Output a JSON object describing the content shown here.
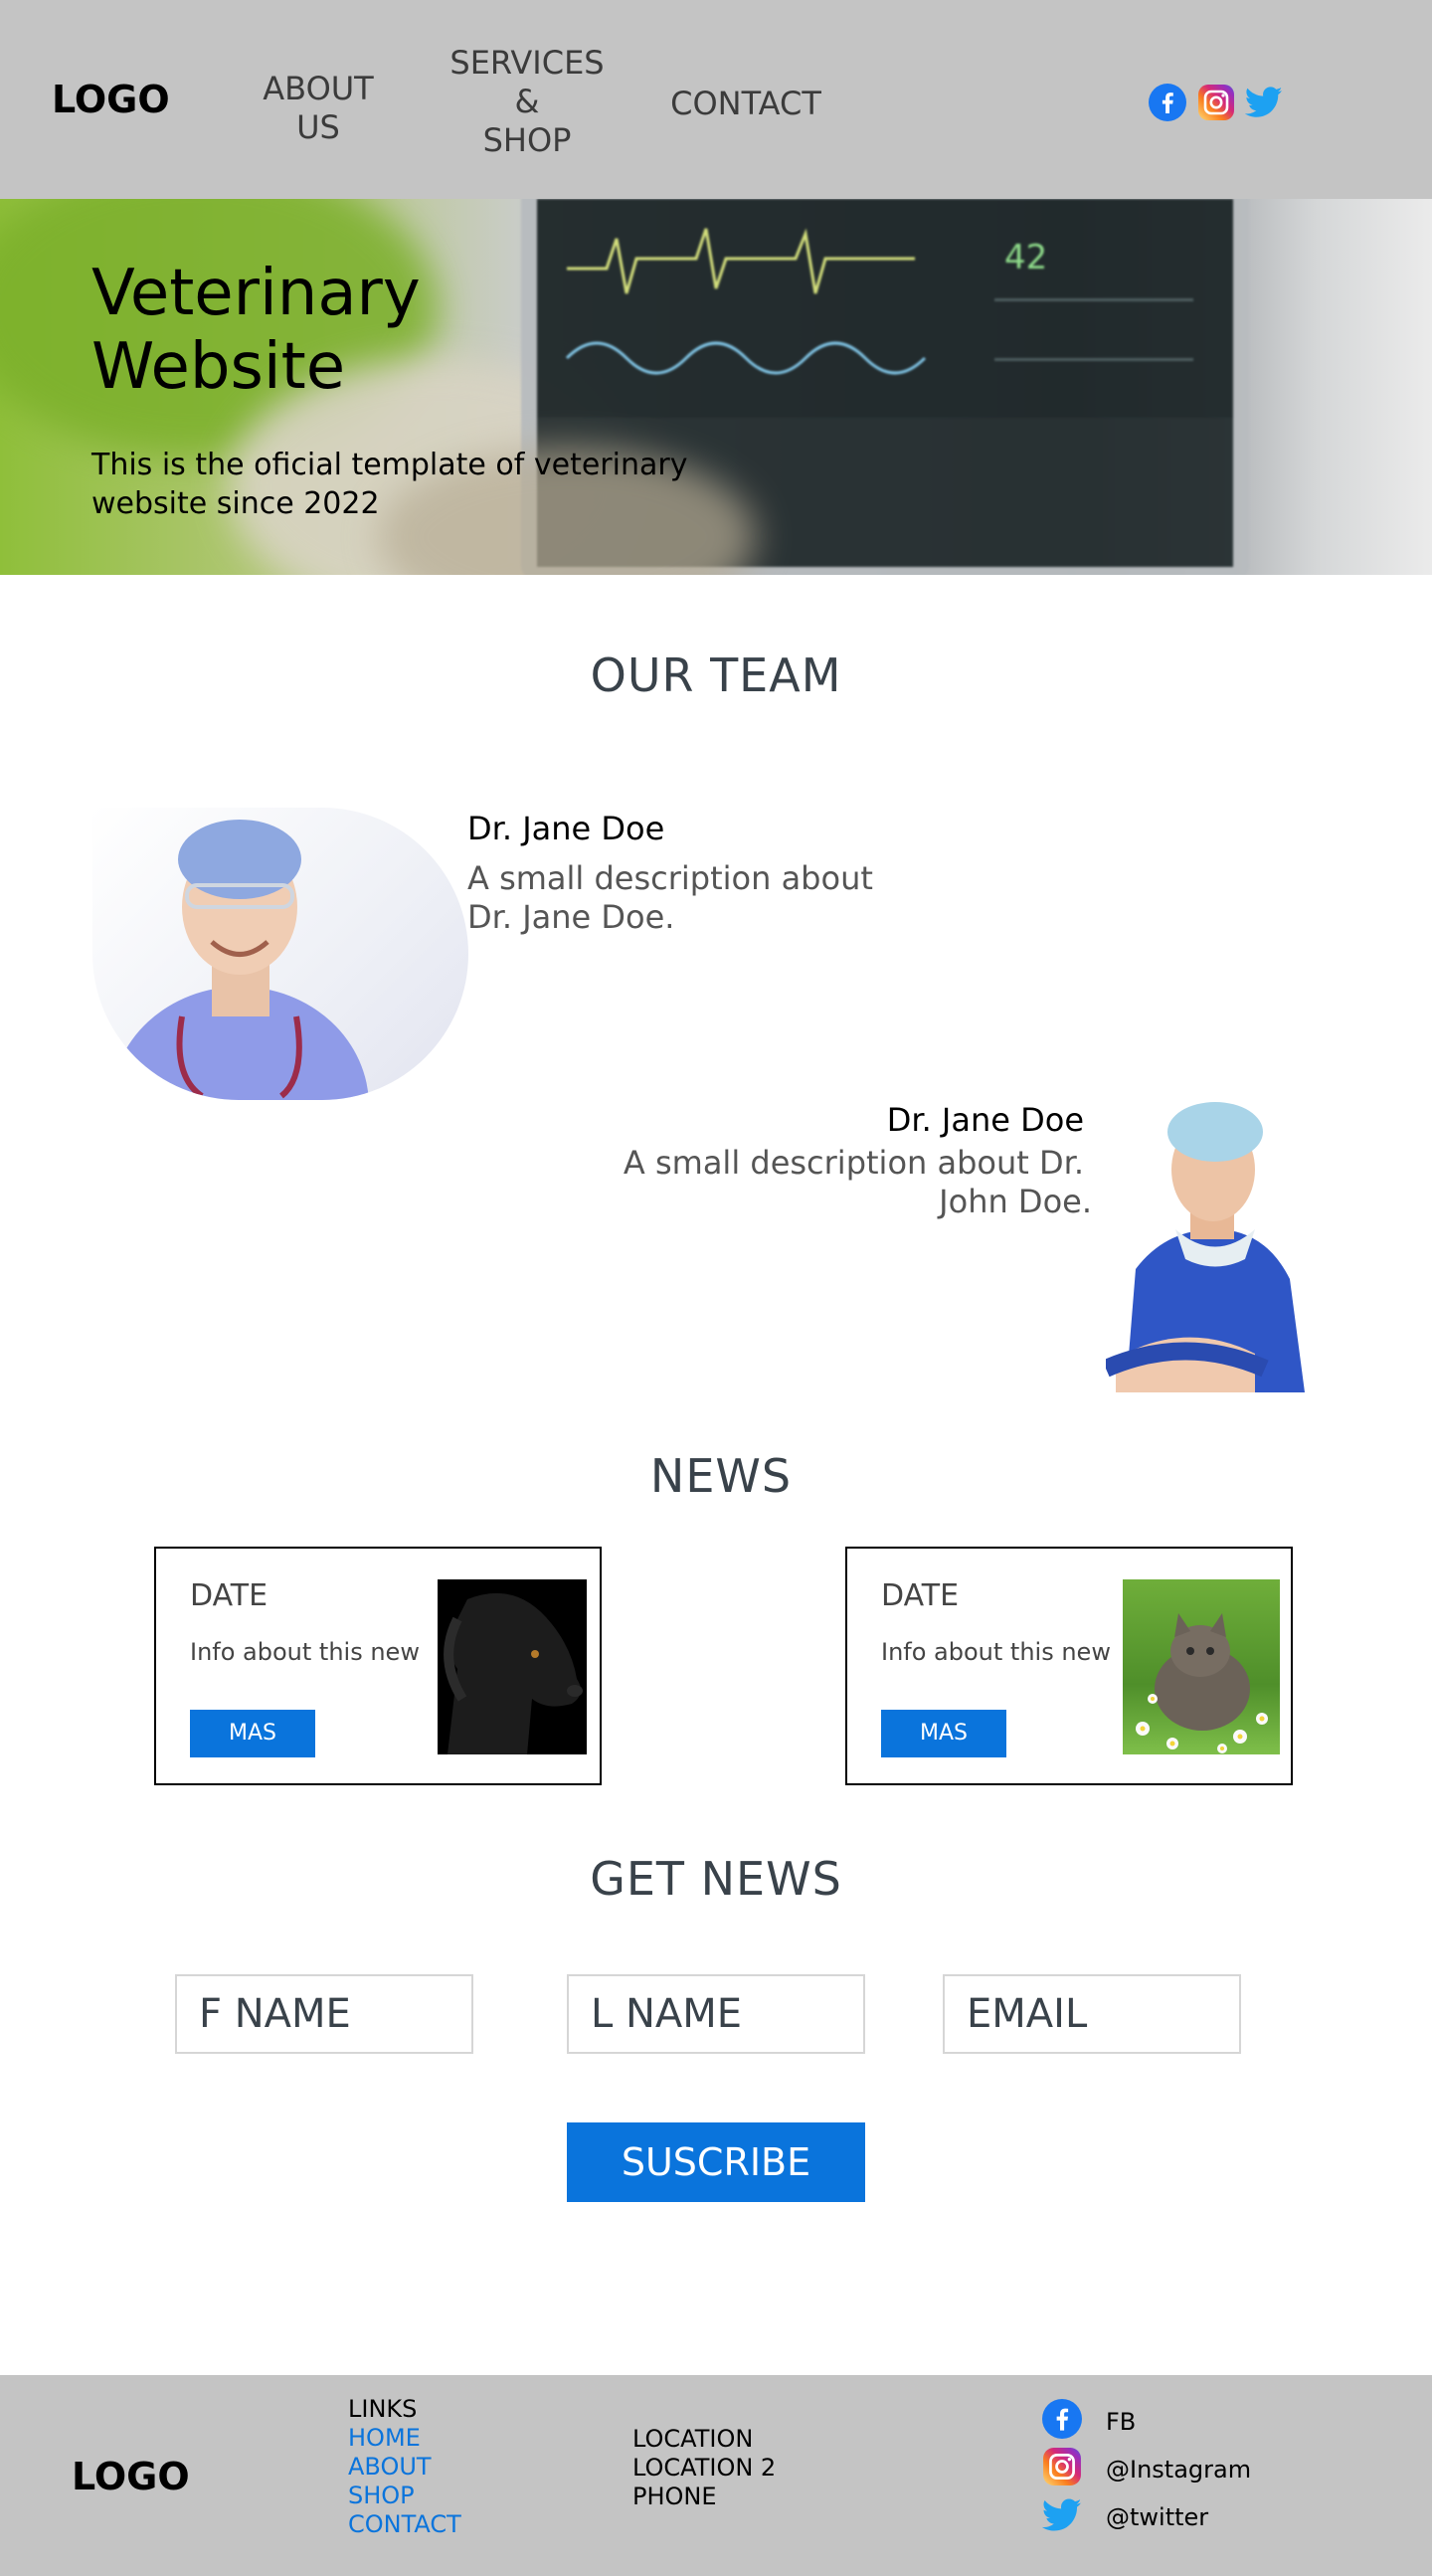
{
  "header": {
    "logo": "LOGO",
    "nav": {
      "about_line1": "ABOUT",
      "about_line2": "US",
      "services_line1": "SERVICES",
      "services_line2": "&",
      "services_line3": "SHOP",
      "contact": "CONTACT"
    },
    "social_icons": [
      "facebook-icon",
      "instagram-icon",
      "twitter-icon"
    ]
  },
  "hero": {
    "title_line1": "Veterinary",
    "title_line2": "Website",
    "subtitle": "This is the oficial template of veterinary website since 2022"
  },
  "team": {
    "title": "OUR TEAM",
    "members": [
      {
        "name": "Dr.  Jane Doe",
        "description": "A small description about Dr. Jane Doe."
      },
      {
        "name": "Dr.  Jane Doe",
        "description_line1": "A small description about Dr.",
        "description_line2": "John Doe."
      }
    ]
  },
  "news": {
    "title": "NEWS",
    "cards": [
      {
        "date": "DATE",
        "info": "Info about this new",
        "button": "MAS"
      },
      {
        "date": "DATE",
        "info": "Info about this new",
        "button": "MAS"
      }
    ]
  },
  "get_news": {
    "title": "GET NEWS",
    "first_name_placeholder": "F NAME",
    "last_name_placeholder": "L NAME",
    "email_placeholder": "EMAIL",
    "subscribe_button": "SUSCRIBE"
  },
  "footer": {
    "logo": "LOGO",
    "links_title": "LINKS",
    "links": [
      "HOME",
      "ABOUT",
      "SHOP",
      "CONTACT"
    ],
    "locations": [
      "LOCATION",
      "LOCATION 2",
      "PHONE"
    ],
    "social": [
      {
        "icon": "facebook-icon",
        "label": "FB"
      },
      {
        "icon": "instagram-icon",
        "label": "@Instagram"
      },
      {
        "icon": "twitter-icon",
        "label": "@twitter"
      }
    ]
  },
  "colors": {
    "header_bg": "#c4c4c4",
    "accent_blue": "#0a74dc",
    "heading": "#39424a",
    "facebook": "#1877f2",
    "twitter": "#1da1f2"
  }
}
